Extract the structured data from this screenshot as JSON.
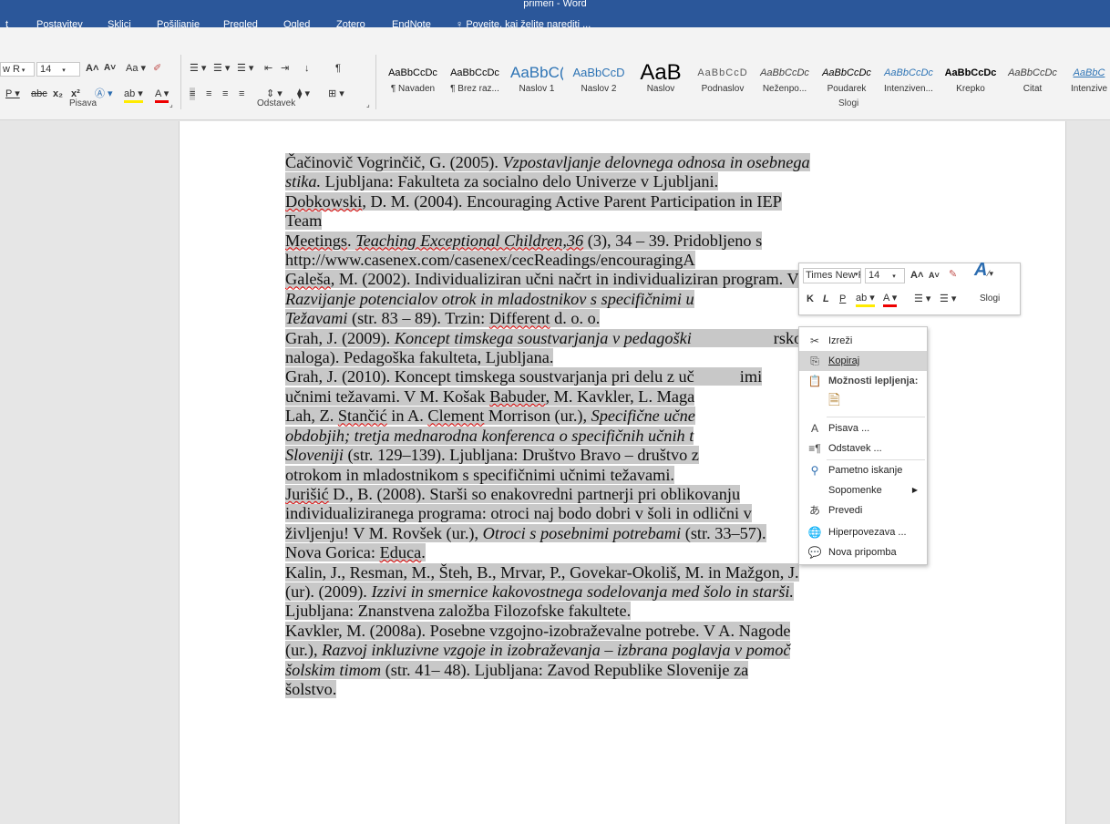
{
  "window": {
    "title": "primeri - Word"
  },
  "tabs": [
    "t",
    "Postavitev",
    "Sklici",
    "Pošiljanje",
    "Pregled",
    "Ogled",
    "Zotero",
    "EndNote"
  ],
  "tell_me": "Povejte, kaj želite narediti ...",
  "ribbon": {
    "font_name": "w R",
    "font_size": "14",
    "group_font": "Pisava",
    "group_paragraph": "Odstavek",
    "group_styles": "Slogi",
    "styles": [
      {
        "sample": "AaBbCcDc",
        "name": "¶ Navaden"
      },
      {
        "sample": "AaBbCcDc",
        "name": "¶ Brez raz..."
      },
      {
        "sample": "AaBbC(",
        "name": "Naslov 1"
      },
      {
        "sample": "AaBbCcD",
        "name": "Naslov 2"
      },
      {
        "sample": "AaB",
        "name": "Naslov"
      },
      {
        "sample": "AaBbCcD",
        "name": "Podnaslov"
      },
      {
        "sample": "AaBbCcDc",
        "name": "Neženpo..."
      },
      {
        "sample": "AaBbCcDc",
        "name": "Poudarek"
      },
      {
        "sample": "AaBbCcDc",
        "name": "Intenziven..."
      },
      {
        "sample": "AaBbCcDc",
        "name": "Krepko"
      },
      {
        "sample": "AaBbCcDc",
        "name": "Citat"
      },
      {
        "sample": "AaBbC",
        "name": "Intenzive"
      }
    ]
  },
  "document": {
    "l1a": "Čačinovič Vogrinčič, G. (2005). ",
    "l1b": "Vzpostavljanje delovnega odnosa in osebnega",
    "l2a": "stika.",
    "l2b": " Ljubljana: Fakulteta za socialno delo Univerze v Ljubljani.",
    "l3a": "Dobkowski",
    "l3b": ", D. M. (2004). Encouraging Active Parent Participation in IEP",
    "l4": "Team",
    "l5a": "Meetings",
    "l5b": ". ",
    "l5c": "Teaching Exceptional Children,36",
    "l5d": " (3), 34 – 39. Pridobljeno s",
    "l6": "http://www.casenex.com/casenex/cecReadings/encouragingA",
    "l7a": "Galeša",
    "l7b": ", M. (2002). Individualiziran učni načrt in individualiziran program. V",
    "l8": "Razvijanje potencialov otrok in mladostnikov s specifičnimi u",
    "l9a": "Težavami",
    "l9b": " (str. 83 – 89). Trzin: ",
    "l9c": "Different",
    "l9d": " d. o. o.",
    "l10a": "Grah, J. (2009). ",
    "l10b": "Koncept timskega soustvarjanja v pedagoški",
    "l10c": "rsko",
    "l11": "naloga). Pedagoška fakulteta, Ljubljana.",
    "l12a": "Grah, J. (2010). Koncept timskega soustvarjanja pri delu z uč",
    "l12b": "imi",
    "l13a": "učnimi težavami. V M. Košak ",
    "l13b": "Babuder",
    "l13c": ", M. Kavkler, L. Maga",
    "l14a": "Lah, Z. ",
    "l14b": "Stančić",
    "l14c": " in A. ",
    "l14d": "Clement",
    "l14e": " Morrison (ur.), ",
    "l14f": "Specifične učne",
    "l15": "obdobjih; tretja mednarodna konferenca o specifičnih učnih t",
    "l16a": "Sloveniji",
    "l16b": " (str. 129–139). Ljubljana: Društvo Bravo – društvo z",
    "l17": "otrokom in mladostnikom s specifičnimi učnimi težavami.",
    "l18a": "Jurišić",
    "l18b": " D., B. (2008). Starši so enakovredni partnerji pri oblikovanju",
    "l19": "individualiziranega programa: otroci naj bodo dobri v šoli in odlični v",
    "l20a": "življenju! V M. Rovšek (ur.), ",
    "l20b": "Otroci s posebnimi potrebami",
    "l20c": " (str. 33–57).",
    "l21a": "Nova Gorica: ",
    "l21b": "Educa",
    "l21c": ".",
    "l22": "Kalin, J., Resman, M., Šteh, B., Mrvar, P., Govekar-Okoliš, M. in Mažgon, J.",
    "l23a": "(ur). (2009). ",
    "l23b": "Izzivi in smernice kakovostnega sodelovanja med šolo in starši.",
    "l24": "Ljubljana: Znanstvena založba Filozofske fakultete.",
    "l25": "Kavkler, M. (2008a). Posebne vzgojno-izobraževalne potrebe. V A. Nagode",
    "l26a": "(ur.), ",
    "l26b": "Razvoj inkluzivne vzgoje in izobraževanja – izbrana poglavja v pomoč",
    "l27a": "šolskim timom",
    "l27b": " (str. 41– 48). Ljubljana: Zavod Republike Slovenije za",
    "l28": "šolstvo."
  },
  "minibar": {
    "font": "Times New Ro",
    "size": "14",
    "styles_label": "Slogi"
  },
  "context_menu": {
    "cut": "Izreži",
    "copy": "Kopiraj",
    "paste_options": "Možnosti lepljenja:",
    "font": "Pisava ...",
    "paragraph": "Odstavek ...",
    "smart_lookup": "Pametno iskanje",
    "synonyms": "Sopomenke",
    "translate": "Prevedi",
    "hyperlink": "Hiperpovezava ...",
    "new_comment": "Nova pripomba"
  }
}
